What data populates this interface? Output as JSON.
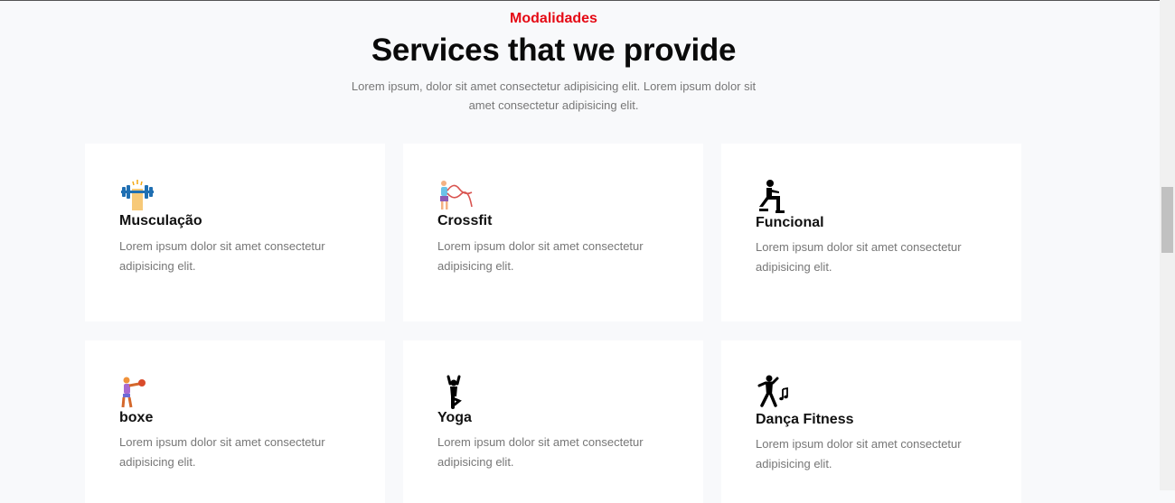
{
  "section": {
    "eyebrow": "Modalidades",
    "title": "Services that we provide",
    "description": "Lorem ipsum, dolor sit amet consectetur adipisicing elit. Lorem ipsum dolor sit amet consectetur adipisicing elit."
  },
  "services": [
    {
      "title": "Musculação",
      "text": "Lorem ipsum dolor sit amet consectetur adipisicing elit.",
      "icon": "weightlifting-icon"
    },
    {
      "title": "Crossfit",
      "text": "Lorem ipsum dolor sit amet consectetur adipisicing elit.",
      "icon": "battle-ropes-icon"
    },
    {
      "title": "Funcional",
      "text": "Lorem ipsum dolor sit amet consectetur adipisicing elit.",
      "icon": "lunge-exercise-icon"
    },
    {
      "title": "boxe",
      "text": "Lorem ipsum dolor sit amet consectetur adipisicing elit.",
      "icon": "boxing-icon"
    },
    {
      "title": "Yoga",
      "text": "Lorem ipsum dolor sit amet consectetur adipisicing elit.",
      "icon": "yoga-pose-icon"
    },
    {
      "title": "Dança Fitness",
      "text": "Lorem ipsum dolor sit amet consectetur adipisicing elit.",
      "icon": "dancing-icon"
    }
  ],
  "colors": {
    "accent": "#e50914",
    "card": "#ffffff",
    "background": "#f8f9fb"
  }
}
